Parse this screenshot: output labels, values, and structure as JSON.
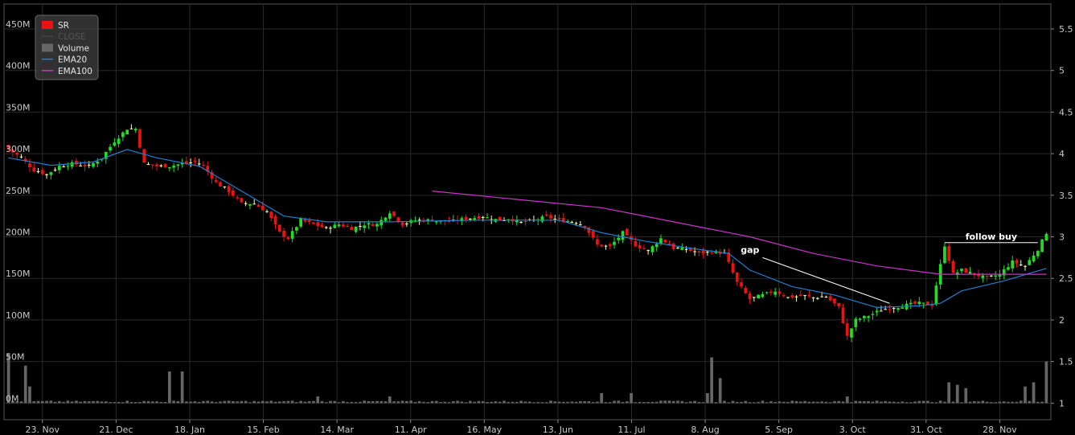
{
  "colors": {
    "background": "#000000",
    "grid": "#2a2a2a",
    "axis_text": "#c8c8c8",
    "up_candle": "#22dd22",
    "down_candle": "#ee1111",
    "doji": "#ffffaa",
    "volume": "#666666",
    "ema20": "#1f7fd0",
    "ema100": "#cc33cc",
    "annotation": "#ffffff",
    "legend_bg": "#3a3a3a"
  },
  "legend": {
    "items": [
      {
        "label": "SR",
        "swatch": "#ee1111",
        "kind": "box"
      },
      {
        "label": "CLOSE",
        "swatch": "#444444",
        "kind": "line",
        "muted": true
      },
      {
        "label": "Volume",
        "swatch": "#666666",
        "kind": "box"
      },
      {
        "label": "EMA20",
        "swatch": "#1f7fd0",
        "kind": "line"
      },
      {
        "label": "EMA100",
        "swatch": "#cc33cc",
        "kind": "line"
      }
    ]
  },
  "chart_data": {
    "type": "candlestick",
    "x_ticks": [
      "23. Nov",
      "21. Dec",
      "18. Jan",
      "15. Feb",
      "14. Mar",
      "11. Apr",
      "16. May",
      "13. Jun",
      "11. Jul",
      "8. Aug",
      "5. Sep",
      "3. Oct",
      "31. Oct",
      "28. Nov"
    ],
    "price_axis": {
      "position": "right",
      "ticks": [
        "1",
        "1.5",
        "2",
        "2.5",
        "3",
        "3.5",
        "4",
        "4.5",
        "5",
        "5.5"
      ],
      "range": [
        0.8,
        5.8
      ]
    },
    "volume_axis": {
      "position": "left",
      "ticks": [
        "0M",
        "50M",
        "100M",
        "150M",
        "200M",
        "250M",
        "300M",
        "350M",
        "400M",
        "450M"
      ],
      "range": [
        -20,
        480
      ]
    },
    "grid": true,
    "legend_position": "top-left",
    "close_path": [
      [
        0,
        4.05
      ],
      [
        3,
        3.95
      ],
      [
        6,
        3.8
      ],
      [
        9,
        3.75
      ],
      [
        12,
        3.85
      ],
      [
        15,
        3.88
      ],
      [
        19,
        3.85
      ],
      [
        22,
        3.95
      ],
      [
        25,
        4.15
      ],
      [
        28,
        4.3
      ],
      [
        30,
        4.3
      ],
      [
        32,
        3.88
      ],
      [
        35,
        3.85
      ],
      [
        38,
        3.85
      ],
      [
        41,
        3.88
      ],
      [
        44,
        3.9
      ],
      [
        46,
        3.85
      ],
      [
        49,
        3.65
      ],
      [
        52,
        3.55
      ],
      [
        55,
        3.4
      ],
      [
        58,
        3.4
      ],
      [
        61,
        3.3
      ],
      [
        64,
        3.05
      ],
      [
        66,
        2.98
      ],
      [
        69,
        3.2
      ],
      [
        72,
        3.15
      ],
      [
        75,
        3.1
      ],
      [
        78,
        3.15
      ],
      [
        81,
        3.1
      ],
      [
        84,
        3.15
      ],
      [
        87,
        3.15
      ],
      [
        90,
        3.3
      ],
      [
        93,
        3.15
      ],
      [
        96,
        3.2
      ],
      [
        100,
        3.2
      ],
      [
        104,
        3.18
      ],
      [
        108,
        3.22
      ],
      [
        112,
        3.24
      ],
      [
        116,
        3.2
      ],
      [
        118,
        3.22
      ],
      [
        121,
        3.17
      ],
      [
        124,
        3.2
      ],
      [
        127,
        3.24
      ],
      [
        130,
        3.2
      ],
      [
        134,
        3.18
      ],
      [
        136,
        3.13
      ],
      [
        139,
        2.9
      ],
      [
        142,
        2.88
      ],
      [
        145,
        3.05
      ],
      [
        148,
        2.9
      ],
      [
        151,
        2.83
      ],
      [
        154,
        2.98
      ],
      [
        157,
        2.86
      ],
      [
        160,
        2.85
      ],
      [
        163,
        2.8
      ],
      [
        166,
        2.82
      ],
      [
        169,
        2.8
      ],
      [
        172,
        2.45
      ],
      [
        175,
        2.25
      ],
      [
        178,
        2.3
      ],
      [
        181,
        2.35
      ],
      [
        184,
        2.27
      ],
      [
        187,
        2.29
      ],
      [
        190,
        2.27
      ],
      [
        193,
        2.28
      ],
      [
        196,
        2.15
      ],
      [
        198,
        1.8
      ],
      [
        200,
        2.0
      ],
      [
        203,
        2.05
      ],
      [
        206,
        2.12
      ],
      [
        209,
        2.15
      ],
      [
        212,
        2.18
      ],
      [
        215,
        2.2
      ],
      [
        218,
        2.18
      ],
      [
        221,
        2.9
      ],
      [
        223,
        2.55
      ],
      [
        225,
        2.6
      ],
      [
        228,
        2.55
      ],
      [
        231,
        2.5
      ],
      [
        234,
        2.55
      ],
      [
        237,
        2.7
      ],
      [
        240,
        2.65
      ],
      [
        243,
        2.85
      ],
      [
        245,
        3.05
      ]
    ],
    "candle_count": 246,
    "ema20": [
      [
        0,
        3.95
      ],
      [
        10,
        3.86
      ],
      [
        20,
        3.9
      ],
      [
        28,
        4.05
      ],
      [
        35,
        3.95
      ],
      [
        45,
        3.85
      ],
      [
        55,
        3.55
      ],
      [
        65,
        3.25
      ],
      [
        75,
        3.18
      ],
      [
        90,
        3.18
      ],
      [
        110,
        3.2
      ],
      [
        130,
        3.2
      ],
      [
        140,
        3.05
      ],
      [
        150,
        2.95
      ],
      [
        160,
        2.87
      ],
      [
        170,
        2.8
      ],
      [
        175,
        2.6
      ],
      [
        185,
        2.4
      ],
      [
        195,
        2.3
      ],
      [
        205,
        2.15
      ],
      [
        215,
        2.17
      ],
      [
        220,
        2.2
      ],
      [
        225,
        2.35
      ],
      [
        235,
        2.47
      ],
      [
        245,
        2.62
      ]
    ],
    "ema100": [
      [
        100,
        3.55
      ],
      [
        120,
        3.45
      ],
      [
        140,
        3.35
      ],
      [
        160,
        3.15
      ],
      [
        175,
        3.0
      ],
      [
        190,
        2.8
      ],
      [
        205,
        2.65
      ],
      [
        220,
        2.55
      ],
      [
        245,
        2.55
      ]
    ],
    "volume_spikes": [
      [
        0,
        60
      ],
      [
        4,
        45
      ],
      [
        5,
        20
      ],
      [
        38,
        38
      ],
      [
        41,
        38
      ],
      [
        73,
        8
      ],
      [
        90,
        8
      ],
      [
        140,
        12
      ],
      [
        147,
        12
      ],
      [
        165,
        12
      ],
      [
        166,
        55
      ],
      [
        168,
        30
      ],
      [
        198,
        8
      ],
      [
        222,
        25
      ],
      [
        224,
        22
      ],
      [
        226,
        18
      ],
      [
        240,
        20
      ],
      [
        242,
        25
      ],
      [
        245,
        50
      ]
    ],
    "annotations": [
      {
        "text": "gap",
        "line_from": [
          208,
          2.2
        ],
        "line_to": [
          178,
          2.75
        ]
      },
      {
        "text": "follow buy",
        "line_from": [
          221,
          2.93
        ],
        "line_to": [
          243,
          2.93
        ]
      }
    ]
  }
}
